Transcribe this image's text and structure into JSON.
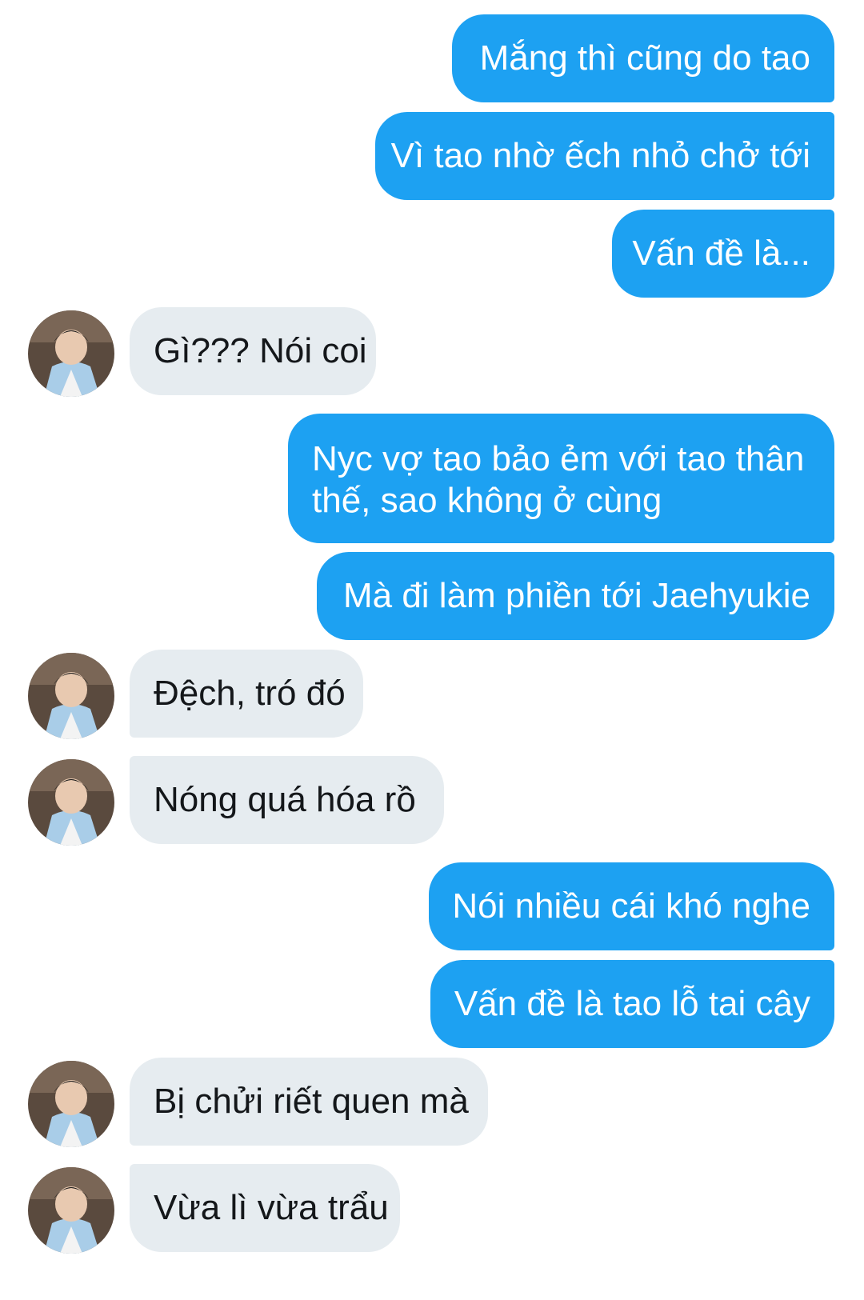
{
  "colors": {
    "outgoing_bubble": "#1da1f2",
    "incoming_bubble": "#e6ecf0",
    "outgoing_text": "#ffffff",
    "incoming_text": "#14171a"
  },
  "avatar": {
    "icon": "user-avatar-photo"
  },
  "messages": [
    {
      "direction": "out",
      "text": "Mắng thì cũng do tao"
    },
    {
      "direction": "out",
      "text": "Vì tao nhờ ếch nhỏ chở tới"
    },
    {
      "direction": "out",
      "text": "Vấn đề là..."
    },
    {
      "direction": "in",
      "text": "Gì??? Nói coi"
    },
    {
      "direction": "out",
      "text": "Nyc vợ tao bảo ẻm với tao thân thế, sao không ở cùng"
    },
    {
      "direction": "out",
      "text": "Mà đi làm phiền tới Jaehyukie"
    },
    {
      "direction": "in",
      "text": "Đệch, tró đó"
    },
    {
      "direction": "in",
      "text": "Nóng quá hóa rồ"
    },
    {
      "direction": "out",
      "text": "Nói nhiều cái khó nghe"
    },
    {
      "direction": "out",
      "text": "Vấn đề là tao lỗ tai cây"
    },
    {
      "direction": "in",
      "text": "Bị chửi riết quen mà"
    },
    {
      "direction": "in",
      "text": "Vừa lì vừa trẩu"
    }
  ]
}
